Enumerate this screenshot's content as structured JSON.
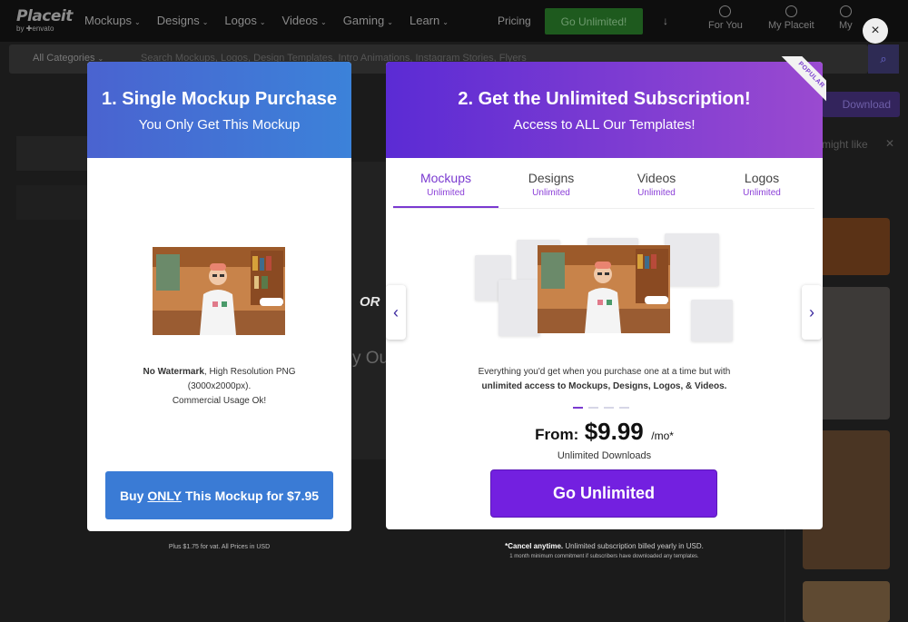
{
  "nav": {
    "brand": "Placeit",
    "brand_sub": "by ✚envato",
    "links": [
      "Mockups",
      "Designs",
      "Logos",
      "Videos",
      "Gaming",
      "Learn"
    ],
    "pricing": "Pricing",
    "go_unlimited": "Go Unlimited!",
    "for_you": "For You",
    "my_placeit": "My Placeit",
    "my_short": "My"
  },
  "search": {
    "category": "All Categories",
    "placeholder": "Search Mockups, Logos, Design Templates, Intro Animations, Instagram Stories, Flyers"
  },
  "bg": {
    "download": "Download",
    "might_like": "might like",
    "or": "OR",
    "partial": "y Ou"
  },
  "close": "×",
  "card1": {
    "title": "1. Single Mockup Purchase",
    "subtitle": "You Only Get This Mockup",
    "no_watermark": "No Watermark",
    "res_line": ", High Resolution PNG",
    "res_dims": "(3000x2000px).",
    "usage": "Commercial Usage Ok!",
    "buy_pre": "Buy",
    "buy_only": "ONLY",
    "buy_post": "This Mockup for $7.95"
  },
  "card2": {
    "ribbon": "POPULAR",
    "title": "2. Get the Unlimited Subscription!",
    "subtitle": "Access to ALL Our Templates!",
    "tabs": [
      {
        "name": "Mockups",
        "sub": "Unlimited"
      },
      {
        "name": "Designs",
        "sub": "Unlimited"
      },
      {
        "name": "Videos",
        "sub": "Unlimited"
      },
      {
        "name": "Logos",
        "sub": "Unlimited"
      }
    ],
    "desc_line1": "Everything you'd get when you purchase one at a time but with",
    "desc_bold": "unlimited access to Mockups, Designs, Logos, & Videos.",
    "price_from": "From:",
    "price_amount": "$9.99",
    "price_per": "/mo*",
    "unlimited_downloads": "Unlimited Downloads",
    "cta": "Go Unlimited"
  },
  "footnotes": {
    "vat": "Plus $1.75 for vat. All Prices in USD",
    "cancel_bold": "*Cancel anytime.",
    "cancel_rest": " Unlimited subscription billed yearly in USD.",
    "commitment": "1 month minimum commitment if subscribers have downloaded any templates."
  },
  "colors": {
    "card1_header": "#3c82d9",
    "card2_header": "#7a3ad0",
    "buy_button": "#3a7bd5",
    "go_button": "#7320e0"
  }
}
